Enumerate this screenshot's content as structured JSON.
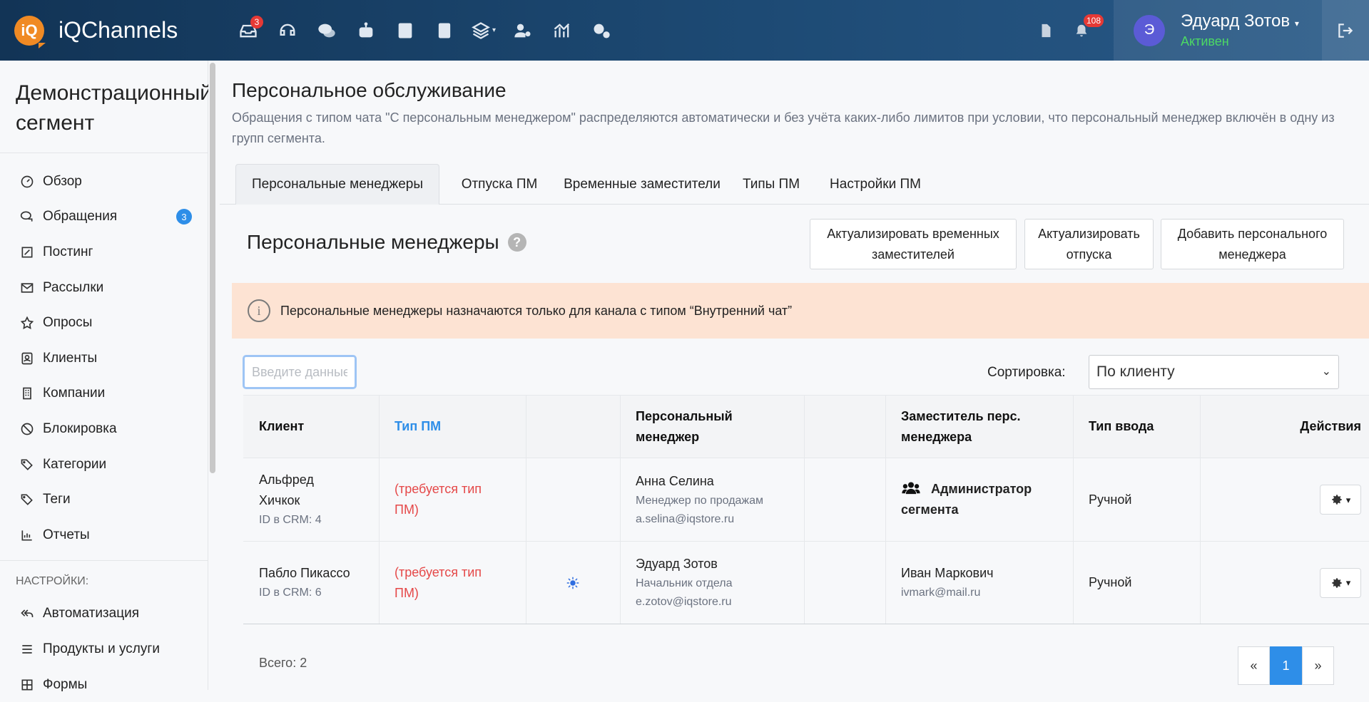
{
  "app": {
    "logo_mark": "iQ",
    "name": "iQChannels"
  },
  "topnav": {
    "icons": [
      "inbox-icon",
      "headset-icon",
      "chat-icon",
      "robot-icon",
      "contact-card-icon",
      "book-icon",
      "layers-icon",
      "user-cog-icon",
      "analytics-icon",
      "settings-icon"
    ],
    "inbox_badge": "3",
    "notifications_badge": "108"
  },
  "user": {
    "initial": "Э",
    "name": "Эдуард Зотов",
    "status": "Активен"
  },
  "sidebar": {
    "segment_title": "Демонстрационный сегмент",
    "items": [
      {
        "label": "Обзор",
        "icon": "gauge-icon"
      },
      {
        "label": "Обращения",
        "icon": "chat-icon",
        "badge": "3"
      },
      {
        "label": "Постинг",
        "icon": "edit-icon"
      },
      {
        "label": "Рассылки",
        "icon": "mail-icon"
      },
      {
        "label": "Опросы",
        "icon": "star-icon"
      },
      {
        "label": "Клиенты",
        "icon": "contact-icon"
      },
      {
        "label": "Компании",
        "icon": "building-icon"
      },
      {
        "label": "Блокировка",
        "icon": "block-icon"
      },
      {
        "label": "Категории",
        "icon": "tags-icon"
      },
      {
        "label": "Теги",
        "icon": "tag-icon"
      },
      {
        "label": "Отчеты",
        "icon": "bar-chart-icon"
      }
    ],
    "settings_section": "НАСТРОЙКИ:",
    "settings_items": [
      {
        "label": "Автоматизация",
        "icon": "reply-all-icon"
      },
      {
        "label": "Продукты и услуги",
        "icon": "list-icon"
      },
      {
        "label": "Формы",
        "icon": "grid-icon"
      }
    ]
  },
  "page": {
    "title": "Персональное обслуживание",
    "description": "Обращения с типом чата \"С персональным менеджером\" распределяются автоматически и без учёта каких-либо лимитов при условии, что персональный менеджер включён в одну из групп сегмента.",
    "tabs": [
      "Персональные менеджеры",
      "Отпуска ПМ",
      "Временные заместители",
      "Типы ПМ",
      "Настройки ПМ"
    ]
  },
  "card": {
    "title": "Персональные менеджеры",
    "help": "?",
    "buttons": {
      "refresh_deputies": "Актуализировать временных заместителей",
      "refresh_vacations": "Актуализировать отпуска",
      "add_manager": "Добавить персонального менеджера"
    },
    "alert_icon": "i",
    "alert": "Персональные менеджеры назначаются только для канала с типом “Внутренний чат”",
    "search_placeholder": "Введите данные клиента",
    "sort_label": "Сортировка:",
    "sort_value": "По клиенту"
  },
  "table": {
    "headers": {
      "client": "Клиент",
      "pm_type": "Тип ПМ",
      "manager": "Персональный менеджер",
      "deputy": "Заместитель перс. менеджера",
      "input_type": "Тип ввода",
      "actions": "Действия"
    },
    "rows": [
      {
        "client": "Альфред Хичкок",
        "crm": "ID в CRM: 4",
        "pm_type": "(требуется тип ПМ)",
        "manager": "Анна Селина",
        "manager_role": "Менеджер по продажам",
        "manager_email": "a.selina@iqstore.ru",
        "deputy": "Администратор сегмента",
        "input_type": "Ручной"
      },
      {
        "client": "Пабло Пикассо",
        "crm": "ID в CRM: 6",
        "pm_type": "(требуется тип ПМ)",
        "manager": "Эдуард Зотов",
        "manager_role": "Начальник отдела",
        "manager_email": "e.zotov@iqstore.ru",
        "deputy": "Иван Маркович",
        "deputy_email": "ivmark@mail.ru",
        "input_type": "Ручной"
      }
    ],
    "total": "Всего: 2",
    "pagination": {
      "prev": "«",
      "current": "1",
      "next": "»"
    }
  }
}
